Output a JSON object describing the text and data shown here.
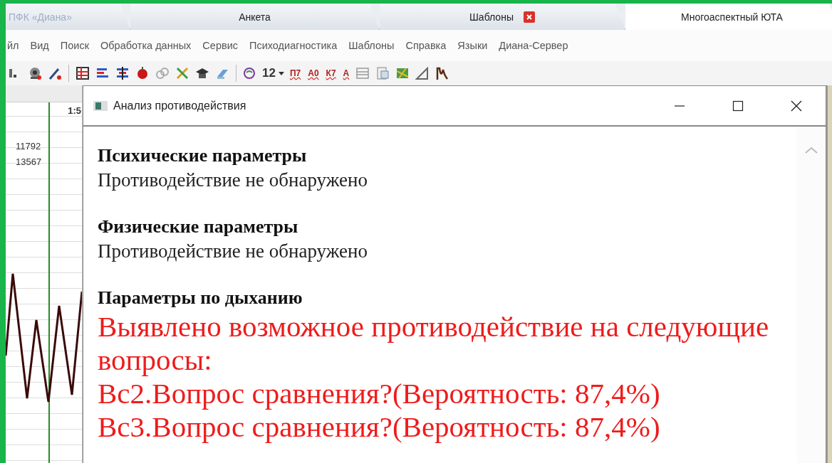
{
  "tabs": [
    {
      "label": "ПФК «Диана»",
      "selected": false,
      "closable": false,
      "faded": true
    },
    {
      "label": "Анкета",
      "selected": false,
      "closable": false,
      "faded": false
    },
    {
      "label": "Шаблоны",
      "selected": false,
      "closable": true,
      "faded": false
    },
    {
      "label": "Многоаспектный ЮТА",
      "selected": true,
      "closable": false,
      "faded": false
    }
  ],
  "menu": [
    "йл",
    "Вид",
    "Поиск",
    "Обработка данных",
    "Сервис",
    "Психодиагностика",
    "Шаблоны",
    "Справка",
    "Языки",
    "Диана-Сервер"
  ],
  "toolbar": {
    "font_size": "12",
    "letter_buttons": [
      "П7",
      "А0",
      "К7",
      "А"
    ]
  },
  "chart": {
    "time_label": "1:5",
    "readings": [
      "11792",
      "13567"
    ]
  },
  "dialog": {
    "title": "Анализ противодействия",
    "sections": [
      {
        "kind": "normal",
        "heading": "Психические параметры",
        "lines": [
          "Противодействие не обнаружено"
        ]
      },
      {
        "kind": "normal",
        "heading": "Физические параметры",
        "lines": [
          "Противодействие не обнаружено"
        ]
      },
      {
        "kind": "alert",
        "heading": "Параметры по дыханию",
        "lines": [
          "Выявлено возможное противодействие на следующие вопросы:",
          "Вс2.Вопрос сравнения?(Вероятность: 87,4%)",
          "Вс3.Вопрос сравнения?(Вероятность: 87,4%)"
        ]
      }
    ]
  }
}
